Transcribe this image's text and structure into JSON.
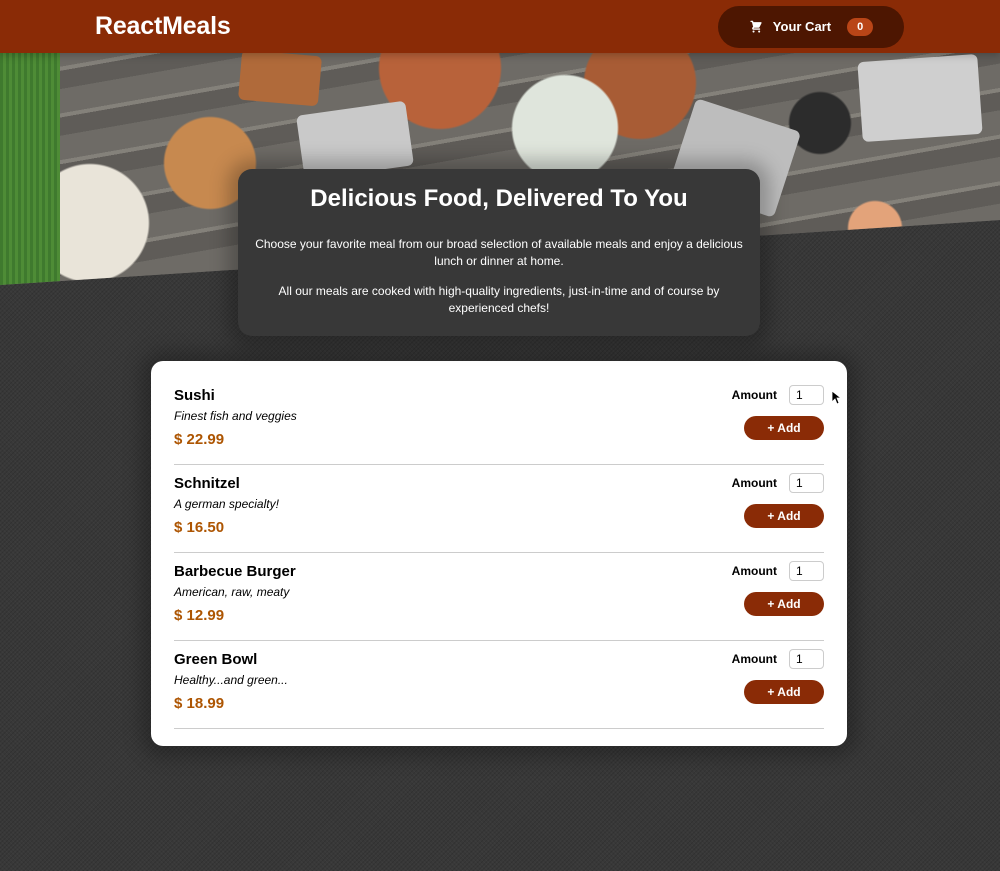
{
  "header": {
    "brand": "ReactMeals",
    "cart_label": "Your Cart",
    "cart_count": "0"
  },
  "summary": {
    "title": "Delicious Food, Delivered To You",
    "paragraph1": "Choose your favorite meal from our broad selection of available meals and enjoy a delicious lunch or dinner at home.",
    "paragraph2": "All our meals are cooked with high-quality ingredients, just-in-time and of course by experienced chefs!"
  },
  "meals": [
    {
      "name": "Sushi",
      "description": "Finest fish and veggies",
      "price": "$ 22.99",
      "amount_label": "Amount",
      "amount_value": "1",
      "add_label": "+ Add"
    },
    {
      "name": "Schnitzel",
      "description": "A german specialty!",
      "price": "$ 16.50",
      "amount_label": "Amount",
      "amount_value": "1",
      "add_label": "+ Add"
    },
    {
      "name": "Barbecue Burger",
      "description": "American, raw, meaty",
      "price": "$ 12.99",
      "amount_label": "Amount",
      "amount_value": "1",
      "add_label": "+ Add"
    },
    {
      "name": "Green Bowl",
      "description": "Healthy...and green...",
      "price": "$ 18.99",
      "amount_label": "Amount",
      "amount_value": "1",
      "add_label": "+ Add"
    }
  ],
  "icons": {
    "cart": "cart-icon"
  },
  "colors": {
    "header": "#8a2b06",
    "cart_button": "#4d1601",
    "badge": "#b94517",
    "price": "#ad5502"
  }
}
